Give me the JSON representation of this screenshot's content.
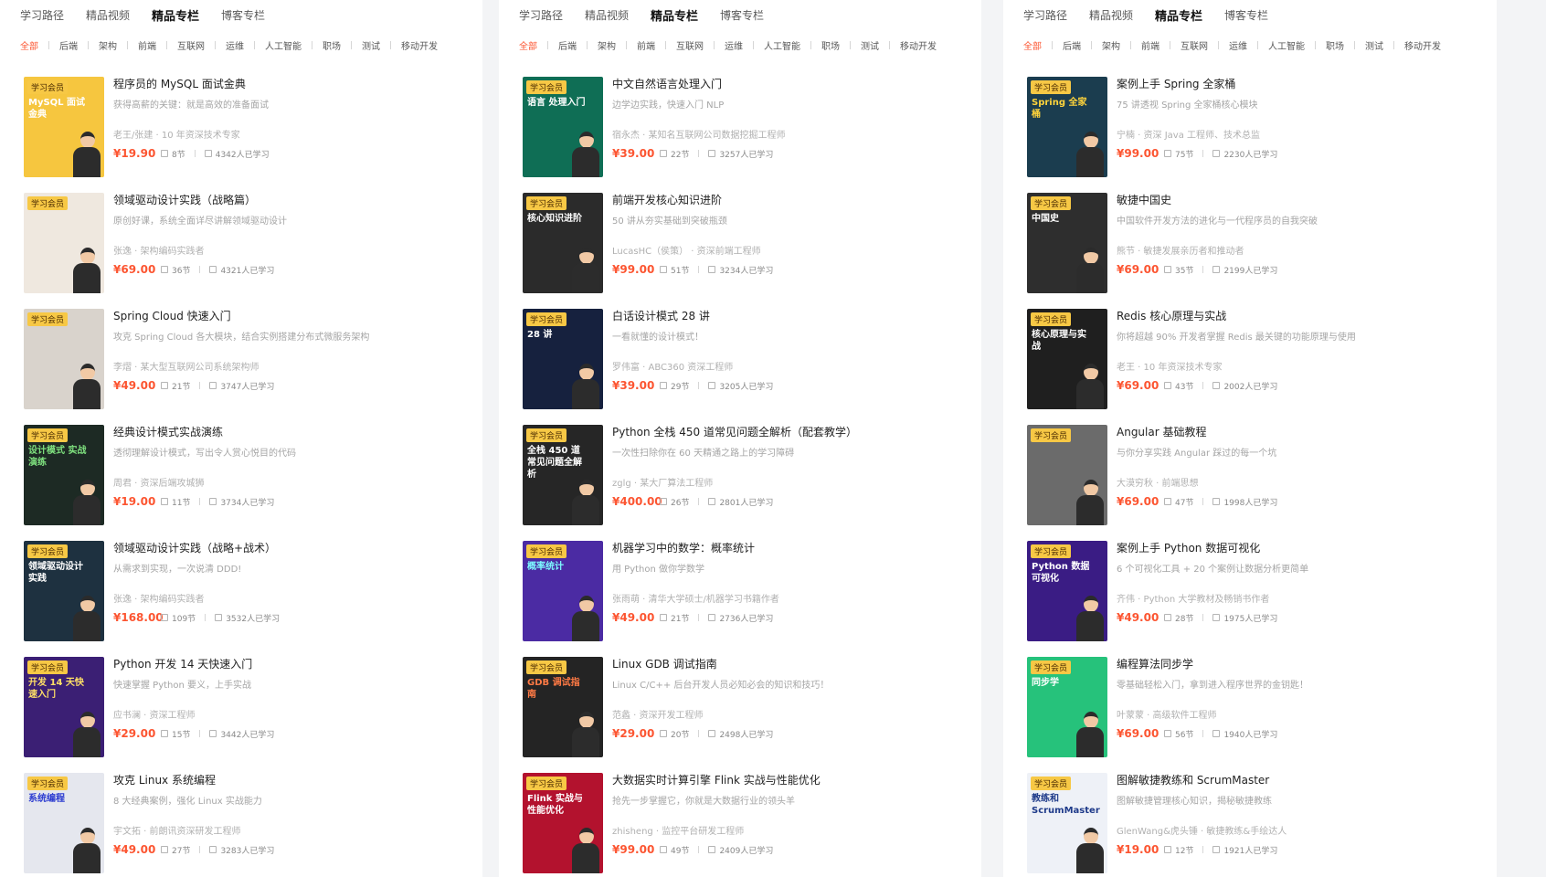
{
  "columns": [
    {
      "tabs": [
        {
          "label": "学习路径",
          "active": false
        },
        {
          "label": "精品视频",
          "active": false
        },
        {
          "label": "精品专栏",
          "active": true
        },
        {
          "label": "博客专栏",
          "active": false
        }
      ],
      "categories": [
        {
          "label": "全部",
          "active": true
        },
        {
          "label": "后端",
          "active": false
        },
        {
          "label": "架构",
          "active": false
        },
        {
          "label": "前端",
          "active": false
        },
        {
          "label": "互联网",
          "active": false
        },
        {
          "label": "运维",
          "active": false
        },
        {
          "label": "人工智能",
          "active": false
        },
        {
          "label": "职场",
          "active": false
        },
        {
          "label": "测试",
          "active": false
        },
        {
          "label": "移动开发",
          "active": false
        }
      ],
      "items": [
        {
          "title": "程序员的 MySQL 面试金典",
          "desc": "获得高薪的关键：就是高效的准备面试",
          "author": "老王/张建 · 10 年资深技术专家",
          "price": "¥19.90",
          "lessons": "8节",
          "learners": "4342人已学习",
          "badge": "学习会员",
          "cover_text": "MySQL 面试金典",
          "cover_bg": "#f6c63f",
          "cover_fg": "#ffffff"
        },
        {
          "title": "领域驱动设计实践（战略篇）",
          "desc": "原创好课，系统全面详尽讲解领域驱动设计",
          "author": "张逸 · 架构编码实践者",
          "price": "¥69.00",
          "lessons": "36节",
          "learners": "4321人已学习",
          "badge": "学习会员",
          "cover_text": "",
          "cover_bg": "#efe8df",
          "cover_fg": "#333333"
        },
        {
          "title": "Spring Cloud 快速入门",
          "desc": "攻克 Spring Cloud 各大模块，结合实例搭建分布式微服务架构",
          "author": "李熠 · 某大型互联网公司系统架构师",
          "price": "¥49.00",
          "lessons": "21节",
          "learners": "3747人已学习",
          "badge": "学习会员",
          "cover_text": "",
          "cover_bg": "#d9d3cc",
          "cover_fg": "#333333"
        },
        {
          "title": "经典设计模式实战演练",
          "desc": "透彻理解设计模式，写出令人赏心悦目的代码",
          "author": "周君 · 资深后端攻城狮",
          "price": "¥19.00",
          "lessons": "11节",
          "learners": "3734人已学习",
          "badge": "学习会员",
          "cover_text": "设计模式 实战演练",
          "cover_bg": "#1d2a24",
          "cover_fg": "#7ee07e"
        },
        {
          "title": "领域驱动设计实践（战略+战术）",
          "desc": "从需求到实现，一次说清 DDD!",
          "author": "张逸 · 架构编码实践者",
          "price": "¥168.00",
          "lessons": "109节",
          "learners": "3532人已学习",
          "badge": "学习会员",
          "cover_text": "领域驱动设计 实践",
          "cover_bg": "#1e3140",
          "cover_fg": "#ffffff"
        },
        {
          "title": "Python 开发 14 天快速入门",
          "desc": "快速掌握 Python 要义，上手实战",
          "author": "应书澜 · 资深工程师",
          "price": "¥29.00",
          "lessons": "15节",
          "learners": "3442人已学习",
          "badge": "学习会员",
          "cover_text": "开发 14 天快速入门",
          "cover_bg": "#3b1f74",
          "cover_fg": "#ffe066"
        },
        {
          "title": "攻克 Linux 系统编程",
          "desc": "8 大经典案例，强化 Linux 实战能力",
          "author": "宇文拓 · 前朗讯资深研发工程师",
          "price": "¥49.00",
          "lessons": "27节",
          "learners": "3283人已学习",
          "badge": "学习会员",
          "cover_text": "系统编程",
          "cover_bg": "#e5e7ee",
          "cover_fg": "#2b3bd0"
        }
      ]
    },
    {
      "tabs": [
        {
          "label": "学习路径",
          "active": false
        },
        {
          "label": "精品视频",
          "active": false
        },
        {
          "label": "精品专栏",
          "active": true
        },
        {
          "label": "博客专栏",
          "active": false
        }
      ],
      "categories": [
        {
          "label": "全部",
          "active": true
        },
        {
          "label": "后端",
          "active": false
        },
        {
          "label": "架构",
          "active": false
        },
        {
          "label": "前端",
          "active": false
        },
        {
          "label": "互联网",
          "active": false
        },
        {
          "label": "运维",
          "active": false
        },
        {
          "label": "人工智能",
          "active": false
        },
        {
          "label": "职场",
          "active": false
        },
        {
          "label": "测试",
          "active": false
        },
        {
          "label": "移动开发",
          "active": false
        }
      ],
      "items": [
        {
          "title": "中文自然语言处理入门",
          "desc": "边学边实践，快速入门 NLP",
          "author": "宿永杰 · 某知名互联网公司数据挖掘工程师",
          "price": "¥39.00",
          "lessons": "22节",
          "learners": "3257人已学习",
          "badge": "学习会员",
          "cover_text": "语言 处理入门",
          "cover_bg": "#0f6e55",
          "cover_fg": "#ffffff"
        },
        {
          "title": "前端开发核心知识进阶",
          "desc": "50 讲从夯实基础到突破瓶颈",
          "author": "LucasHC（侯策） · 资深前端工程师",
          "price": "¥99.00",
          "lessons": "51节",
          "learners": "3234人已学习",
          "badge": "学习会员",
          "cover_text": "核心知识进阶",
          "cover_bg": "#2b2b2b",
          "cover_fg": "#ffffff"
        },
        {
          "title": "白话设计模式 28 讲",
          "desc": "一看就懂的设计模式！",
          "author": "罗伟富 · ABC360 资深工程师",
          "price": "¥39.00",
          "lessons": "29节",
          "learners": "3205人已学习",
          "badge": "学习会员",
          "cover_text": "28 讲",
          "cover_bg": "#16213e",
          "cover_fg": "#ffffff"
        },
        {
          "title": "Python 全栈 450 道常见问题全解析（配套教学）",
          "desc": "一次性扫除你在 60 天精通之路上的学习障碍",
          "author": "zglg · 某大厂算法工程师",
          "price": "¥400.00",
          "lessons": "26节",
          "learners": "2801人已学习",
          "badge": "学习会员",
          "cover_text": "全栈 450 道常见问题全解析",
          "cover_bg": "#262626",
          "cover_fg": "#ffffff"
        },
        {
          "title": "机器学习中的数学：概率统计",
          "desc": "用 Python 做你学数学",
          "author": "张雨萌 · 清华大学硕士/机器学习书籍作者",
          "price": "¥49.00",
          "lessons": "21节",
          "learners": "2736人已学习",
          "badge": "学习会员",
          "cover_text": "概率统计",
          "cover_bg": "#4b2ba3",
          "cover_fg": "#7df9ff"
        },
        {
          "title": "Linux GDB 调试指南",
          "desc": "Linux C/C++ 后台开发人员必知必会的知识和技巧！",
          "author": "范蠡 · 资深开发工程师",
          "price": "¥29.00",
          "lessons": "20节",
          "learners": "2498人已学习",
          "badge": "学习会员",
          "cover_text": "GDB 调试指南",
          "cover_bg": "#242424",
          "cover_fg": "#ff7a45"
        },
        {
          "title": "大数据实时计算引擎 Flink 实战与性能优化",
          "desc": "抢先一步掌握它，你就是大数据行业的领头羊",
          "author": "zhisheng · 监控平台研发工程师",
          "price": "¥99.00",
          "lessons": "49节",
          "learners": "2409人已学习",
          "badge": "学习会员",
          "cover_text": "Flink 实战与性能优化",
          "cover_bg": "#b3122e",
          "cover_fg": "#ffffff"
        }
      ]
    },
    {
      "tabs": [
        {
          "label": "学习路径",
          "active": false
        },
        {
          "label": "精品视频",
          "active": false
        },
        {
          "label": "精品专栏",
          "active": true
        },
        {
          "label": "博客专栏",
          "active": false
        }
      ],
      "categories": [
        {
          "label": "全部",
          "active": true
        },
        {
          "label": "后端",
          "active": false
        },
        {
          "label": "架构",
          "active": false
        },
        {
          "label": "前端",
          "active": false
        },
        {
          "label": "互联网",
          "active": false
        },
        {
          "label": "运维",
          "active": false
        },
        {
          "label": "人工智能",
          "active": false
        },
        {
          "label": "职场",
          "active": false
        },
        {
          "label": "测试",
          "active": false
        },
        {
          "label": "移动开发",
          "active": false
        }
      ],
      "items": [
        {
          "title": "案例上手 Spring 全家桶",
          "desc": "75 讲透视 Spring 全家桶核心模块",
          "author": "宁楠 · 资深 Java 工程师、技术总监",
          "price": "¥99.00",
          "lessons": "75节",
          "learners": "2230人已学习",
          "badge": "学习会员",
          "cover_text": "Spring 全家桶",
          "cover_bg": "#1b3d4f",
          "cover_fg": "#ffd43b"
        },
        {
          "title": "敏捷中国史",
          "desc": "中国软件开发方法的进化与一代程序员的自我突破",
          "author": "熊节 · 敏捷发展亲历者和推动者",
          "price": "¥69.00",
          "lessons": "35节",
          "learners": "2199人已学习",
          "badge": "学习会员",
          "cover_text": "中国史",
          "cover_bg": "#2e2e2e",
          "cover_fg": "#ffffff"
        },
        {
          "title": "Redis 核心原理与实战",
          "desc": "你将超越 90% 开发者掌握 Redis 最关键的功能原理与使用",
          "author": "老王 · 10 年资深技术专家",
          "price": "¥69.00",
          "lessons": "43节",
          "learners": "2002人已学习",
          "badge": "学习会员",
          "cover_text": "核心原理与实战",
          "cover_bg": "#1f1f1f",
          "cover_fg": "#ffffff"
        },
        {
          "title": "Angular 基础教程",
          "desc": "与你分享实践 Angular 踩过的每一个坑",
          "author": "大漠穷秋 · 前端思想",
          "price": "¥69.00",
          "lessons": "47节",
          "learners": "1998人已学习",
          "badge": "学习会员",
          "cover_text": "",
          "cover_bg": "#6b6b6b",
          "cover_fg": "#ffffff"
        },
        {
          "title": "案例上手 Python 数据可视化",
          "desc": "6 个可视化工具 + 20 个案例让数据分析更简单",
          "author": "齐伟 · Python 大学教材及畅销书作者",
          "price": "¥49.00",
          "lessons": "28节",
          "learners": "1975人已学习",
          "badge": "学习会员",
          "cover_text": "Python 数据可视化",
          "cover_bg": "#3a1c84",
          "cover_fg": "#ffffff"
        },
        {
          "title": "编程算法同步学",
          "desc": "零基础轻松入门，拿到进入程序世界的金钥匙！",
          "author": "叶蒙蒙 · 高级软件工程师",
          "price": "¥69.00",
          "lessons": "56节",
          "learners": "1940人已学习",
          "badge": "学习会员",
          "cover_text": "同步学",
          "cover_bg": "#26c27b",
          "cover_fg": "#ffffff"
        },
        {
          "title": "图解敏捷教练和 ScrumMaster",
          "desc": "图解敏捷管理核心知识，揭秘敏捷教练",
          "author": "GlenWang&虎头锤 · 敏捷教练&手绘达人",
          "price": "¥19.00",
          "lessons": "12节",
          "learners": "1921人已学习",
          "badge": "学习会员",
          "cover_text": "教练和 ScrumMaster",
          "cover_bg": "#eef1f7",
          "cover_fg": "#1f3b8a"
        }
      ]
    }
  ]
}
